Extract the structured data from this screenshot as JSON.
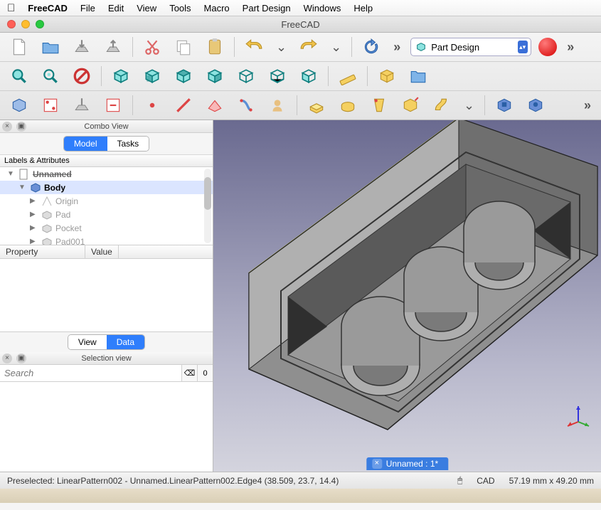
{
  "menu": {
    "items": [
      "FreeCAD",
      "File",
      "Edit",
      "View",
      "Tools",
      "Macro",
      "Part Design",
      "Windows",
      "Help"
    ]
  },
  "window": {
    "title": "FreeCAD"
  },
  "workbench": {
    "selected": "Part Design"
  },
  "combo": {
    "title": "Combo View",
    "tabs": {
      "model": "Model",
      "tasks": "Tasks",
      "active": "model"
    },
    "tree_header": "Labels & Attributes",
    "tree": [
      {
        "label": "Unnamed",
        "depth": 0,
        "expanded": true,
        "bold": true,
        "icon": "doc"
      },
      {
        "label": "Body",
        "depth": 1,
        "expanded": true,
        "bold": true,
        "selected": true,
        "icon": "body"
      },
      {
        "label": "Origin",
        "depth": 2,
        "dim": true,
        "icon": "origin"
      },
      {
        "label": "Pad",
        "depth": 2,
        "dim": true,
        "icon": "feat"
      },
      {
        "label": "Pocket",
        "depth": 2,
        "dim": true,
        "icon": "feat"
      },
      {
        "label": "Pad001",
        "depth": 2,
        "dim": true,
        "icon": "feat"
      }
    ],
    "property": {
      "col1": "Property",
      "col2": "Value"
    },
    "vd_tabs": {
      "view": "View",
      "data": "Data",
      "active": "data"
    }
  },
  "selection_view": {
    "title": "Selection view",
    "placeholder": "Search",
    "count": "0"
  },
  "document_tab": "Unnamed : 1*",
  "status": {
    "preselect": "Preselected: LinearPattern002 - Unnamed.LinearPattern002.Edge4 (38.509, 23.7, 14.4)",
    "mode": "CAD",
    "dims": "57.19 mm x 49.20 mm"
  },
  "colors": {
    "accent": "#2f7efc",
    "cube": "#8de3e0",
    "cube_stroke": "#0f7e7e"
  }
}
